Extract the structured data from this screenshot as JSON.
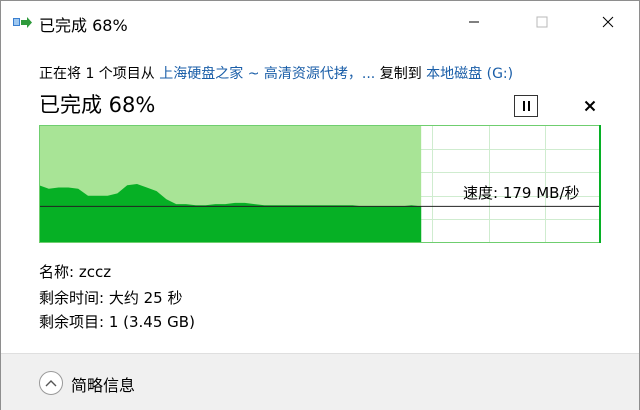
{
  "window": {
    "title": "已完成 68%",
    "app_icon": "copy-arrow-icon"
  },
  "transfer": {
    "prefix": "正在将 1 个项目从 ",
    "source": "上海硬盘之家 ~ 高清资源代拷，...",
    "middle": " 复制到 ",
    "destination": "本地磁盘 (G:)"
  },
  "progress": {
    "title": "已完成 68%",
    "percent": 68,
    "speed_label": "速度: 179 MB/秒"
  },
  "details": {
    "name": "名称: zccz",
    "time_remaining": "剩余时间: 大约 25 秒",
    "items_remaining": "剩余项目: 1 (3.45 GB)"
  },
  "footer": {
    "toggle_label": "简略信息"
  },
  "colors": {
    "fill_dark": "#06b025",
    "fill_light": "#a8e496",
    "grid": "#cfeccf",
    "link": "#1a5ea8"
  },
  "chart_data": {
    "type": "area",
    "progress_percent": 68,
    "current_speed_mb_s": 179,
    "relative_speed": [
      0.49,
      0.46,
      0.47,
      0.47,
      0.46,
      0.4,
      0.4,
      0.4,
      0.42,
      0.49,
      0.5,
      0.47,
      0.44,
      0.37,
      0.33,
      0.33,
      0.32,
      0.32,
      0.33,
      0.33,
      0.34,
      0.34,
      0.33,
      0.32,
      0.32,
      0.32,
      0.32,
      0.32,
      0.32,
      0.32,
      0.32,
      0.32,
      0.32,
      0.31,
      0.31,
      0.31,
      0.31,
      0.31,
      0.32,
      0.31
    ],
    "grid": true
  }
}
